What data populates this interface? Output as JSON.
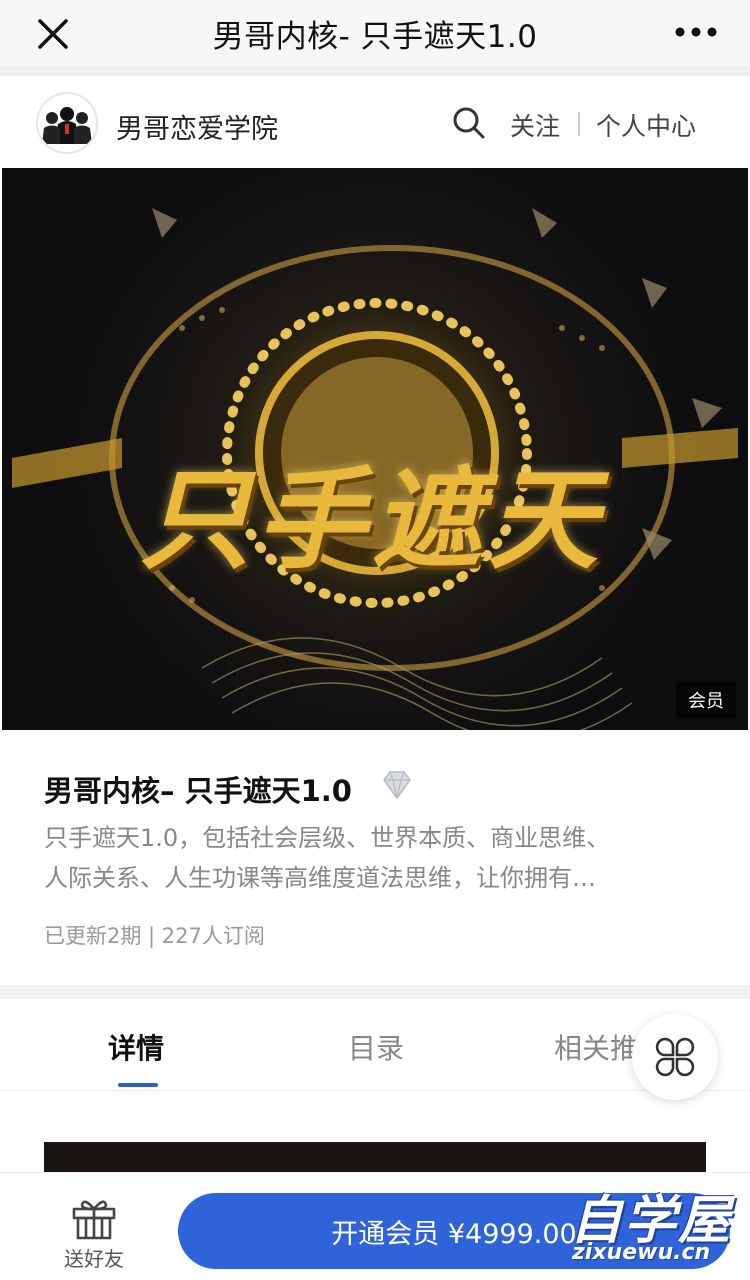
{
  "topbar": {
    "title": "男哥内核- 只手遮天1.0"
  },
  "account": {
    "name": "男哥恋爱学院",
    "follow_label": "关注",
    "center_label": "个人中心"
  },
  "banner": {
    "title_text": "只手遮天",
    "badge": "会员"
  },
  "course": {
    "title": "男哥内核– 只手遮天1.0",
    "description_line1": "只手遮天1.0，包括社会层级、世界本质、商业思维、",
    "description_line2": "人际关系、人生功课等高维度道法思维，让你拥有…",
    "meta": "已更新2期 | 227人订阅"
  },
  "tabs": [
    {
      "label": "详情",
      "active": true
    },
    {
      "label": "目录",
      "active": false
    },
    {
      "label": "相关推",
      "active": false
    }
  ],
  "bottom": {
    "gift_label": "送好友",
    "join_label": "开通会员 ¥4999.00"
  },
  "watermark": {
    "cn": "自学屋",
    "en": "zixuewu.cn"
  },
  "colors": {
    "accent": "#2e63d9",
    "gold": "#d4a32a"
  }
}
